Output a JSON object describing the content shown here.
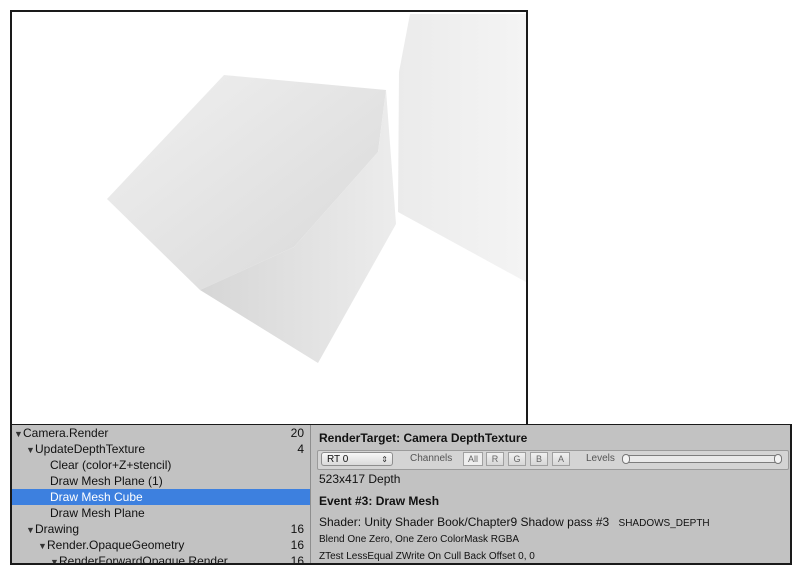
{
  "tree": {
    "items": [
      {
        "label": "Camera.Render",
        "count": "20",
        "depth": 0,
        "expanded": true
      },
      {
        "label": "UpdateDepthTexture",
        "count": "4",
        "depth": 1,
        "expanded": true
      },
      {
        "label": "Clear (color+Z+stencil)",
        "count": "",
        "depth": 3,
        "expanded": false
      },
      {
        "label": "Draw Mesh Plane (1)",
        "count": "",
        "depth": 3,
        "expanded": false
      },
      {
        "label": "Draw Mesh Cube",
        "count": "",
        "depth": 3,
        "expanded": false,
        "selected": true
      },
      {
        "label": "Draw Mesh Plane",
        "count": "",
        "depth": 3,
        "expanded": false
      },
      {
        "label": "Drawing",
        "count": "16",
        "depth": 1,
        "expanded": true
      },
      {
        "label": "Render.OpaqueGeometry",
        "count": "16",
        "depth": 2,
        "expanded": true
      },
      {
        "label": "RenderForwardOpaque.Render",
        "count": "16",
        "depth": 3,
        "expanded": true
      }
    ]
  },
  "details": {
    "render_target": "RenderTarget: Camera DepthTexture",
    "rt_select": "RT 0",
    "channels_label": "Channels",
    "channels": [
      "All",
      "R",
      "G",
      "B",
      "A"
    ],
    "levels_label": "Levels",
    "resolution": "523x417 Depth",
    "event": "Event #3: Draw Mesh",
    "shader": "Shader: Unity Shader Book/Chapter9 Shadow pass #3",
    "keyword": "SHADOWS_DEPTH",
    "blend": "Blend One Zero, One Zero ColorMask RGBA",
    "ztest": "ZTest LessEqual ZWrite On Cull Back Offset 0, 0"
  },
  "icons": {
    "expanded": "▼",
    "select_arrow": "⇕"
  },
  "colors": {
    "selection": "#3d80df",
    "panel": "#c2c2c2"
  }
}
